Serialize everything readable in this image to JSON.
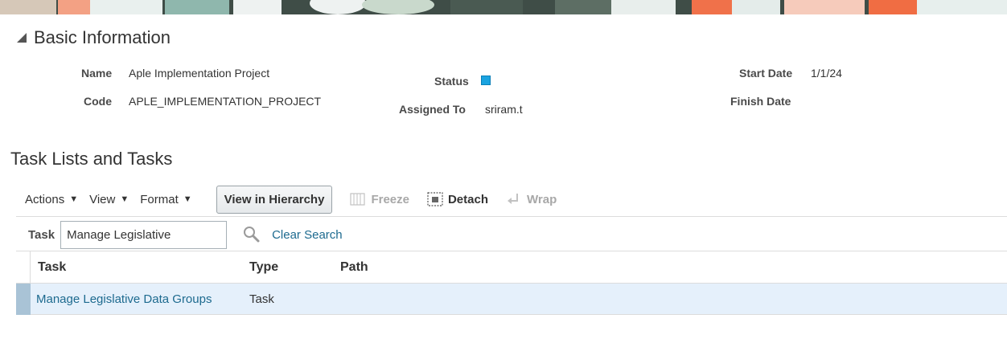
{
  "basic_info": {
    "section_title": "Basic Information",
    "name_label": "Name",
    "name_value": "Aple Implementation Project",
    "code_label": "Code",
    "code_value": "APLE_IMPLEMENTATION_PROJECT",
    "status_label": "Status",
    "status_color": "#1aa3e0",
    "assigned_label": "Assigned To",
    "assigned_value": "sriram.t",
    "start_label": "Start Date",
    "start_value": "1/1/24",
    "finish_label": "Finish Date",
    "finish_value": ""
  },
  "task_lists": {
    "title": "Task Lists and Tasks",
    "toolbar": {
      "actions": "Actions",
      "view": "View",
      "format": "Format",
      "view_hierarchy": "View in Hierarchy",
      "freeze": "Freeze",
      "detach": "Detach",
      "wrap": "Wrap"
    },
    "filter": {
      "label": "Task",
      "value": "Manage Legislative",
      "clear_search": "Clear Search"
    },
    "table": {
      "headers": [
        "Task",
        "Type",
        "Path"
      ],
      "rows": [
        {
          "task": "Manage Legislative Data Groups",
          "type": "Task",
          "path": ""
        }
      ]
    }
  }
}
